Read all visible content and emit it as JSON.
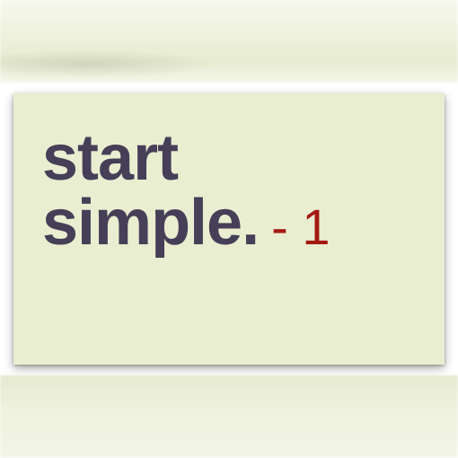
{
  "card": {
    "line1": "start",
    "line2": "simple.",
    "suffix": "- 1"
  },
  "colors": {
    "text": "#463f57",
    "accent": "#a51a12",
    "card_background": "#e9eed1"
  }
}
